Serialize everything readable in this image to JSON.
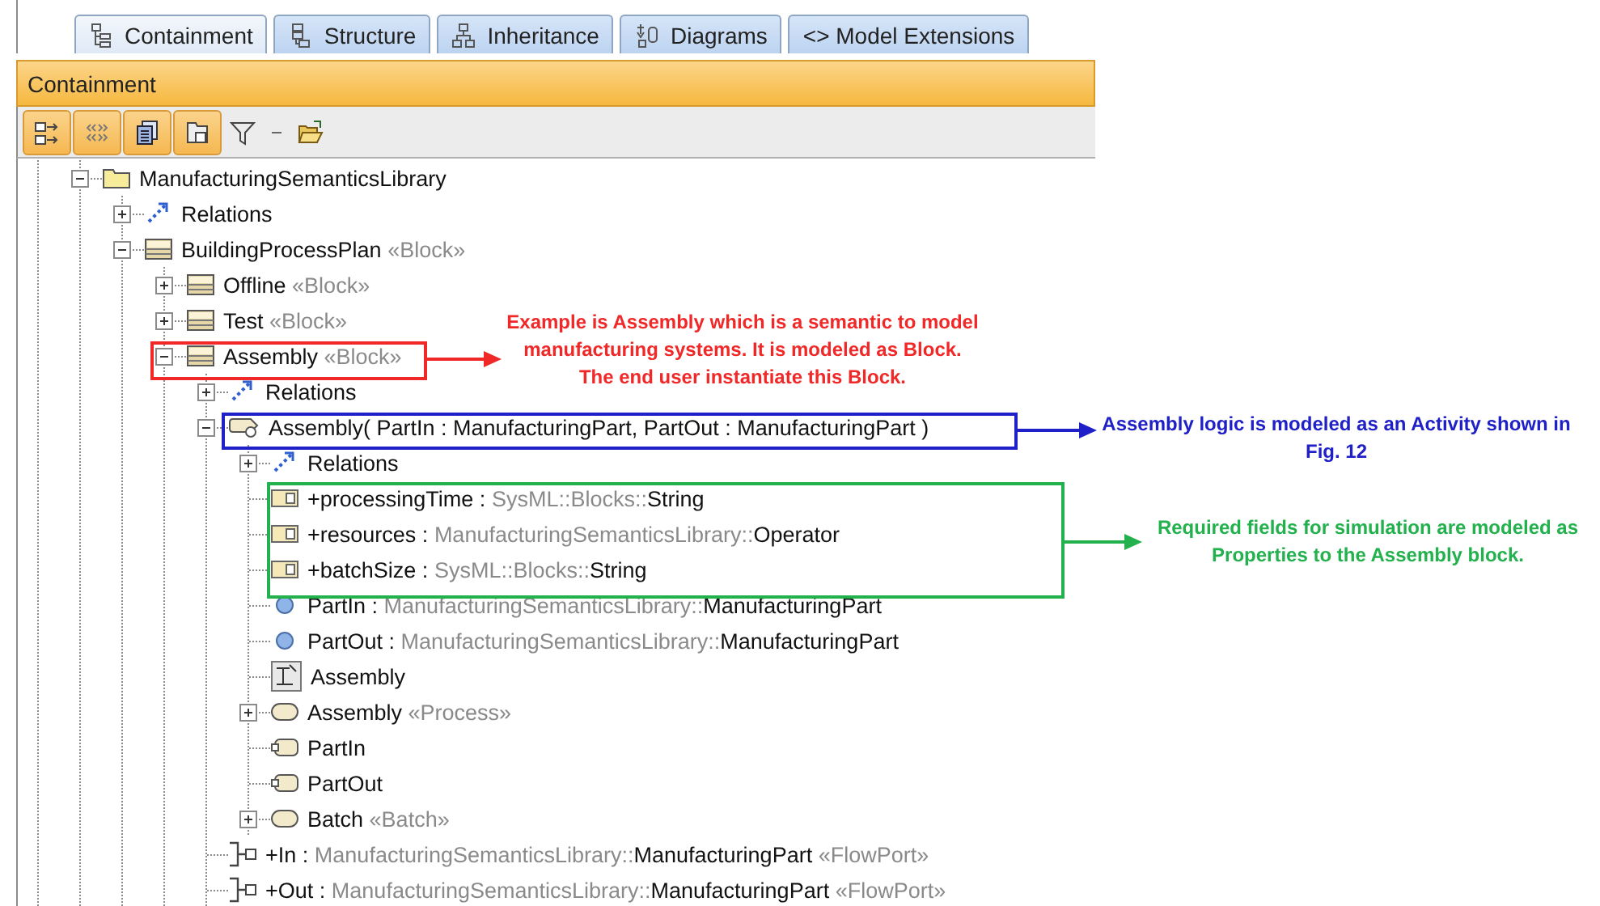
{
  "tabs": [
    {
      "kind": "containment",
      "label": "Containment",
      "selected": true
    },
    {
      "kind": "structure",
      "label": "Structure",
      "selected": false
    },
    {
      "kind": "inheritance",
      "label": "Inheritance",
      "selected": false
    },
    {
      "kind": "diagrams",
      "label": "Diagrams",
      "selected": false
    },
    {
      "kind": "extensions",
      "label": "<> Model Extensions",
      "selected": false
    }
  ],
  "panel": {
    "title": "Containment"
  },
  "toolbar": [
    {
      "kind": "expand-arrows",
      "pressed": true
    },
    {
      "kind": "angle-brackets",
      "pressed": true
    },
    {
      "kind": "documents",
      "pressed": true
    },
    {
      "kind": "folders",
      "pressed": true
    },
    {
      "kind": "filter"
    },
    {
      "kind": "dash"
    },
    {
      "kind": "open-folder"
    }
  ],
  "tree": [
    {
      "kind": "package",
      "label": "ManufacturingSemanticsLibrary",
      "expanded": true,
      "children": [
        {
          "kind": "relations",
          "label": "Relations",
          "expanded": false
        },
        {
          "kind": "block",
          "label": "BuildingProcessPlan",
          "stereotype": "«Block»",
          "expanded": true,
          "children": [
            {
              "kind": "block",
              "label": "Offline",
              "stereotype": "«Block»",
              "expanded": false
            },
            {
              "kind": "block",
              "label": "Test",
              "stereotype": "«Block»",
              "expanded": false
            },
            {
              "kind": "block",
              "label": "Assembly",
              "stereotype": "«Block»",
              "expanded": true,
              "children": [
                {
                  "kind": "relations",
                  "label": "Relations",
                  "expanded": false
                },
                {
                  "kind": "activity",
                  "label": "Assembly( PartIn : ManufacturingPart, PartOut : ManufacturingPart )",
                  "expanded": true,
                  "children": [
                    {
                      "kind": "relations",
                      "label": "Relations",
                      "expanded": false
                    },
                    {
                      "kind": "property",
                      "label": "+processingTime :",
                      "type_prefix": "SysML::Blocks::",
                      "type": "String"
                    },
                    {
                      "kind": "property",
                      "label": "+resources :",
                      "type_prefix": "ManufacturingSemanticsLibrary::",
                      "type": "Operator"
                    },
                    {
                      "kind": "property",
                      "label": "+batchSize :",
                      "type_prefix": "SysML::Blocks::",
                      "type": "String"
                    },
                    {
                      "kind": "parameter",
                      "label": "PartIn :",
                      "type_prefix": "ManufacturingSemanticsLibrary::",
                      "type": "ManufacturingPart"
                    },
                    {
                      "kind": "parameter",
                      "label": "PartOut :",
                      "type_prefix": "ManufacturingSemanticsLibrary::",
                      "type": "ManufacturingPart"
                    },
                    {
                      "kind": "diagram",
                      "label": "Assembly"
                    },
                    {
                      "kind": "action",
                      "label": "Assembly",
                      "stereotype": "«Process»",
                      "expanded": false
                    },
                    {
                      "kind": "pin",
                      "label": "PartIn"
                    },
                    {
                      "kind": "pin",
                      "label": "PartOut"
                    },
                    {
                      "kind": "action",
                      "label": "Batch",
                      "stereotype": "«Batch»",
                      "expanded": false
                    }
                  ]
                },
                {
                  "kind": "port",
                  "label": "+In :",
                  "type_prefix": "ManufacturingSemanticsLibrary::",
                  "type": "ManufacturingPart",
                  "stereotype": "«FlowPort»"
                },
                {
                  "kind": "port",
                  "label": "+Out :",
                  "type_prefix": "ManufacturingSemanticsLibrary::",
                  "type": "ManufacturingPart",
                  "stereotype": "«FlowPort»"
                }
              ]
            }
          ]
        }
      ]
    }
  ],
  "annotations": [
    {
      "text": "Example is Assembly which is a semantic to model manufacturing systems. It is modeled as Block. The end user instantiate this Block.",
      "color": "#f02828"
    },
    {
      "text": "Assembly logic is modeled as an Activity shown in Fig. 12",
      "color": "#2020c8"
    },
    {
      "text": "Required fields for simulation are modeled as Properties to the Assembly block.",
      "color": "#22b14c"
    }
  ]
}
